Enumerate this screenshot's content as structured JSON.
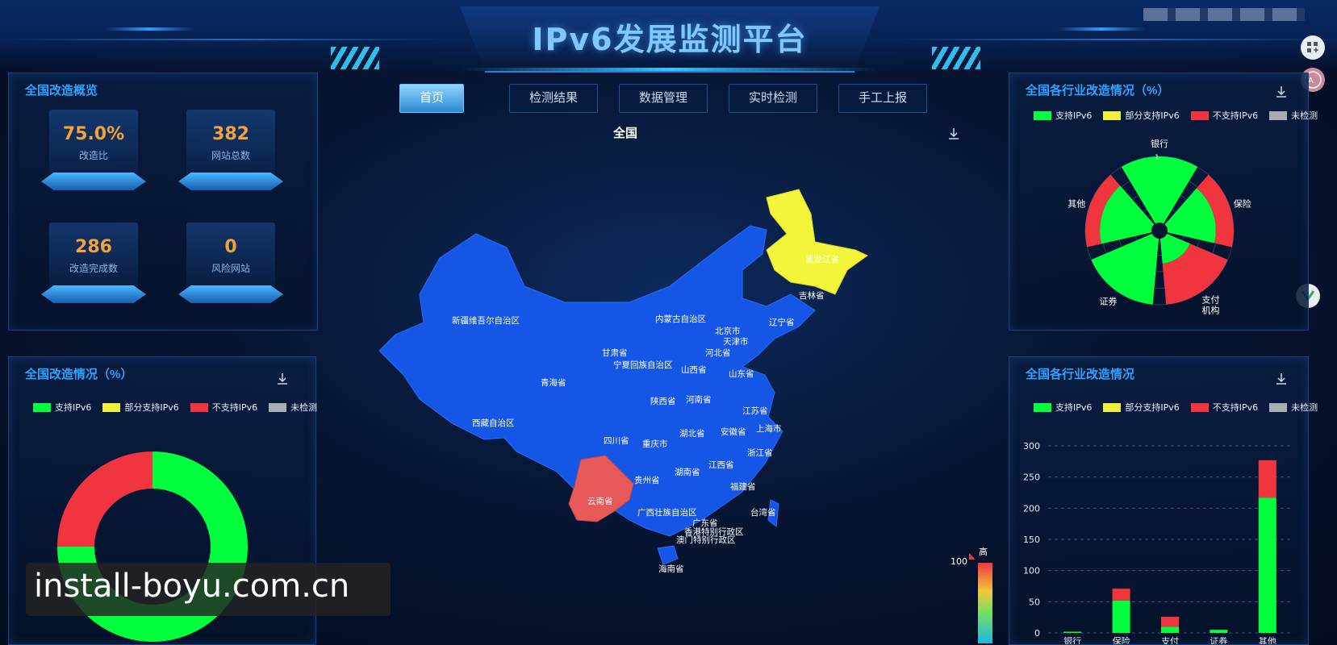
{
  "header": {
    "title": "IPv6发展监测平台"
  },
  "nav": {
    "items": [
      {
        "label": "首页",
        "active": true
      },
      {
        "label": "检测结果",
        "active": false
      },
      {
        "label": "数据管理",
        "active": false
      },
      {
        "label": "实时检测",
        "active": false
      },
      {
        "label": "手工上报",
        "active": false
      }
    ]
  },
  "overview": {
    "title": "全国改造概览",
    "cards": [
      {
        "value": "75.0%",
        "label": "改造比"
      },
      {
        "value": "382",
        "label": "网站总数"
      },
      {
        "value": "286",
        "label": "改造完成数"
      },
      {
        "value": "0",
        "label": "风险网站"
      }
    ]
  },
  "legend": {
    "support": "支持IPv6",
    "partial": "部分支持IPv6",
    "unsupported": "不支持IPv6",
    "unchecked": "未检测"
  },
  "colors": {
    "support": "#00ff3c",
    "partial": "#f3f03a",
    "unsupported": "#f0353f",
    "unchecked": "#a7adb5",
    "map_base": "#1556e6",
    "map_yunnan": "#e85a5a",
    "map_heilongjiang": "#f3f53a",
    "accent": "#2fa3ff"
  },
  "national_status": {
    "title": "全国改造情况（%）",
    "chart_data": {
      "type": "pie",
      "labels": [
        "支持IPv6",
        "部分支持IPv6",
        "不支持IPv6",
        "未检测"
      ],
      "values": [
        75.0,
        0,
        25.0,
        0
      ]
    }
  },
  "map": {
    "title": "全国",
    "scale_high": "高",
    "scale_max": "100",
    "provinces": [
      "新疆维吾尔自治区",
      "内蒙古自治区",
      "黑龙江省",
      "吉林省",
      "辽宁省",
      "北京市",
      "天津市",
      "河北省",
      "甘肃省",
      "宁夏回族自治区",
      "山西省",
      "山东省",
      "青海省",
      "陕西省",
      "河南省",
      "江苏省",
      "西藏自治区",
      "四川省",
      "重庆市",
      "湖北省",
      "安徽省",
      "上海市",
      "浙江省",
      "江西省",
      "湖南省",
      "贵州省",
      "福建省",
      "云南省",
      "广西壮族自治区",
      "广东省",
      "香港特别行政区",
      "澳门特别行政区",
      "台湾省",
      "海南省"
    ]
  },
  "industry_radial": {
    "title": "全国各行业改造情况（%）",
    "chart_data": {
      "type": "pie",
      "categories": [
        "银行",
        "保险",
        "支付机构",
        "证券",
        "其他"
      ],
      "series": [
        {
          "name": "支持IPv6",
          "values": [
            100,
            73,
            38,
            100,
            78
          ]
        },
        {
          "name": "不支持IPv6",
          "values": [
            0,
            27,
            62,
            0,
            22
          ]
        }
      ],
      "radial_axis_label": "1"
    }
  },
  "industry_bar": {
    "title": "全国各行业改造情况",
    "chart_data": {
      "type": "bar",
      "categories": [
        "银行",
        "保险",
        "支付",
        "证券",
        "其他"
      ],
      "series": [
        {
          "name": "支持IPv6",
          "values": [
            2,
            52,
            10,
            5,
            217
          ]
        },
        {
          "name": "不支持IPv6",
          "values": [
            0,
            19,
            16,
            0,
            60
          ]
        }
      ],
      "ylim": [
        0,
        300
      ],
      "yticks": [
        0,
        50,
        100,
        150,
        200,
        250,
        300
      ]
    }
  },
  "watermark": {
    "text": "install-boyu.com.cn"
  }
}
